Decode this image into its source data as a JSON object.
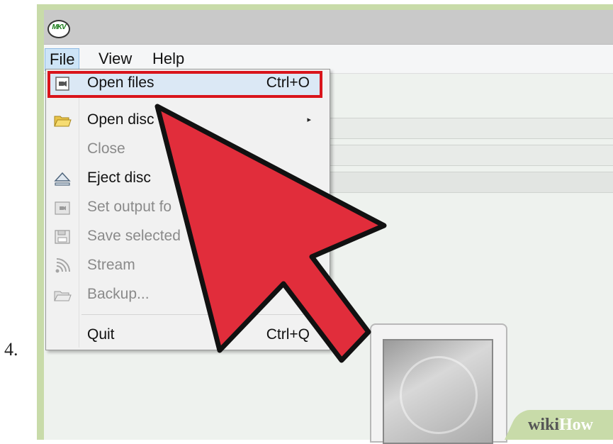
{
  "step_number": "4.",
  "app": {
    "logo_text": "MKV"
  },
  "menubar": {
    "items": [
      "File",
      "View",
      "Help"
    ]
  },
  "file_menu": {
    "items": [
      {
        "label": "Open files",
        "shortcut": "Ctrl+O",
        "icon": "video-file-icon",
        "enabled": true,
        "highlighted": true
      },
      {
        "label": "Open disc",
        "submenu_arrow": "▸",
        "icon": "folder-open-icon",
        "enabled": true
      },
      {
        "label": "Close",
        "enabled": false
      },
      {
        "label": "Eject disc",
        "icon": "eject-icon",
        "enabled": true
      },
      {
        "label": "Set output fo",
        "icon": "output-folder-icon",
        "enabled": false
      },
      {
        "label": "Save selected",
        "icon": "save-icon",
        "enabled": false
      },
      {
        "label": "Stream",
        "icon": "stream-icon",
        "enabled": false
      },
      {
        "label": "Backup...",
        "icon": "backup-icon",
        "enabled": false
      },
      {
        "label": "Quit",
        "shortcut": "Ctrl+Q",
        "enabled": true
      }
    ]
  },
  "watermark": {
    "wiki": "wiki",
    "how": "How"
  },
  "colors": {
    "highlight_border": "#d9141b",
    "arrow_fill": "#e12d3b",
    "frame_green": "#c8dba9",
    "menu_active": "#cde4f7"
  }
}
